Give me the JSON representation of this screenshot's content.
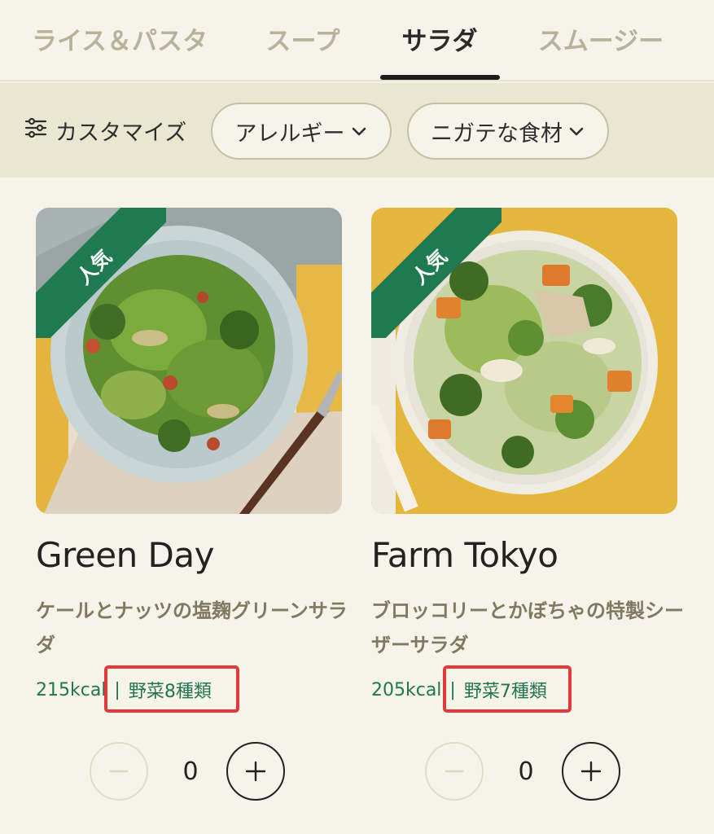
{
  "tabs": [
    {
      "label": "ライス＆パスタ",
      "active": false
    },
    {
      "label": "スープ",
      "active": false
    },
    {
      "label": "サラダ",
      "active": true
    },
    {
      "label": "スムージー",
      "active": false
    }
  ],
  "filters": {
    "customize_label": "カスタマイズ",
    "allergy_label": "アレルギー",
    "dislike_label": "ニガテな食材"
  },
  "products": [
    {
      "badge": "人気",
      "name": "Green Day",
      "description": "ケールとナッツの塩麹グリーンサラダ",
      "calories": "215kcal",
      "separator": "|",
      "vegetables": "野菜8種類",
      "quantity": "0"
    },
    {
      "badge": "人気",
      "name": "Farm Tokyo",
      "description": "ブロッコリーとかぼちゃの特製シーザーサラダ",
      "calories": "205kcal",
      "separator": "|",
      "vegetables": "野菜7種類",
      "quantity": "0"
    }
  ],
  "colors": {
    "background": "#f6f4ea",
    "filter_bar": "#e9e6d2",
    "badge_green": "#1f7a52",
    "meta_green": "#227552",
    "highlight_red": "#e03a3a",
    "tab_inactive": "#b9b29b"
  }
}
